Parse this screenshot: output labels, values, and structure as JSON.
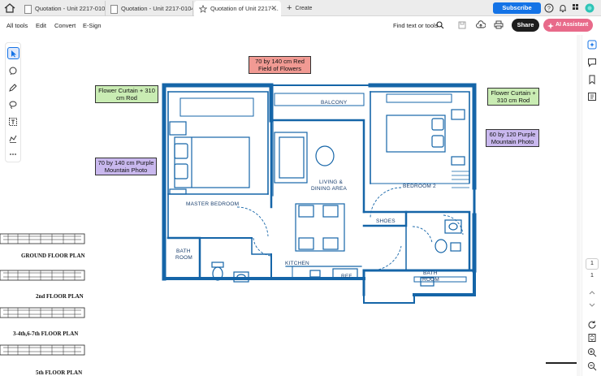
{
  "tabs": [
    {
      "label": "Quotation - Unit 2217-010411 in..."
    },
    {
      "label": "Quotation - Unit 2217-010411 in..."
    },
    {
      "label": "Quotation of Unit 2217-..."
    }
  ],
  "create_label": "Create",
  "subscribe_label": "Subscribe",
  "toolbar": {
    "all_tools": "All tools",
    "edit": "Edit",
    "convert": "Convert",
    "esign": "E-Sign",
    "find": "Find text or tools",
    "share": "Share",
    "ai_assistant": "AI Assistant"
  },
  "annotations": {
    "top_red": [
      "70 by 140 cm Red",
      "Field of Flowers"
    ],
    "left_green": [
      "Flower Curtain + 310",
      "cm Rod"
    ],
    "right_green": [
      "Flower Curtain +",
      "310 cm Rod"
    ],
    "left_purple": [
      "70 by 140 cm Purple",
      "Mountain Photo"
    ],
    "right_purple": [
      "60 by 120 Purple",
      "Mountain Photo"
    ]
  },
  "plan_labels": {
    "balcony": "BALCONY",
    "living": "LIVING &",
    "dining": "DINING AREA",
    "master": "MASTER BEDROOM",
    "bedroom2": "BEDROOM 2",
    "shoes": "SHOES",
    "bath1a": "BATH",
    "bath1b": "ROOM",
    "kitchen": "KITCHEN",
    "ref": "REF.",
    "bath2a": "BATH",
    "bath2b": "ROOM"
  },
  "floor_plan_list": {
    "ground": "GROUND  FLOOR PLAN",
    "second": "2nd  FLOOR PLAN",
    "third": "3-4th,6-7th  FLOOR PLAN",
    "fifth": "5th  FLOOR PLAN"
  },
  "page": {
    "current": "1",
    "total": "1"
  },
  "colors": {
    "accent": "#1473e6",
    "plan_blue": "#1565a8",
    "ai": "#e86a8a"
  }
}
